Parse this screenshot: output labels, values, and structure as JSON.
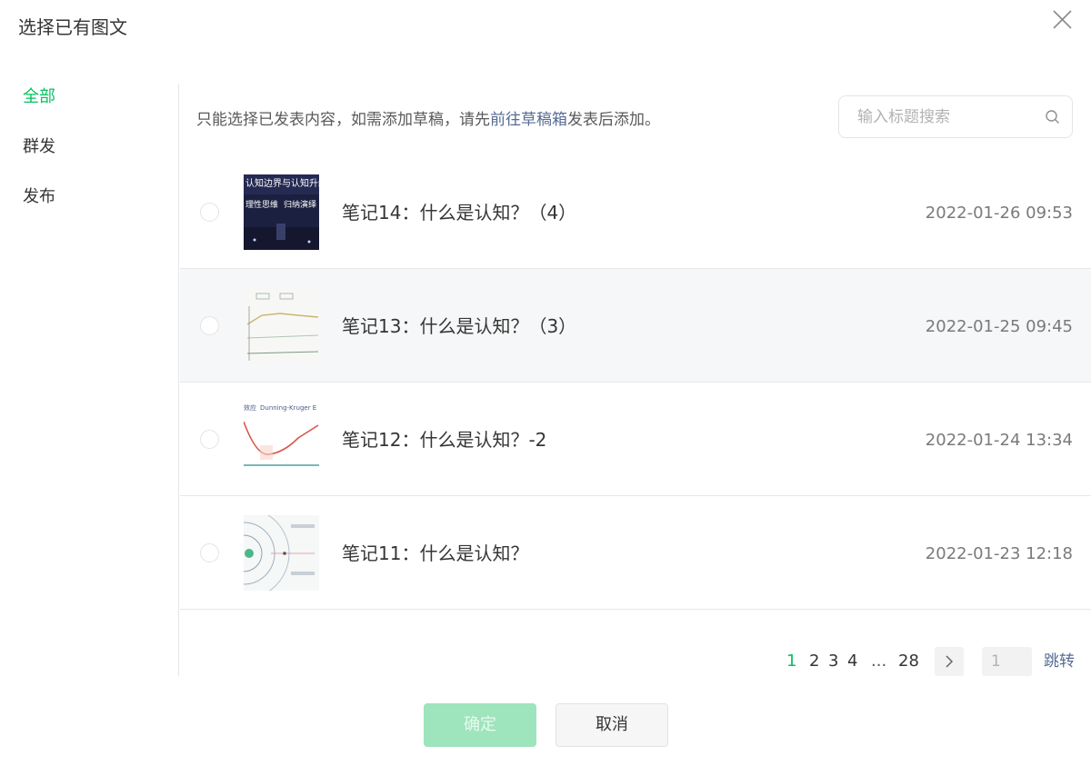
{
  "dialog": {
    "title": "选择已有图文"
  },
  "sidebar": {
    "items": [
      {
        "label": "全部",
        "active": true
      },
      {
        "label": "群发",
        "active": false
      },
      {
        "label": "发布",
        "active": false
      }
    ]
  },
  "notice": {
    "prefix": "只能选择已发表内容，如需添加草稿，请先",
    "link": "前往草稿箱",
    "suffix": "发表后添加。"
  },
  "search": {
    "placeholder": "输入标题搜索"
  },
  "articles": [
    {
      "title": "笔记14：什么是认知？（4）",
      "date": "2022-01-26 09:53",
      "thumb_text_1": "认知边界与认知升级",
      "thumb_text_2": "理性思维",
      "thumb_text_3": "归纳演绎"
    },
    {
      "title": "笔记13：什么是认知？（3）",
      "date": "2022-01-25 09:45"
    },
    {
      "title": "笔记12：什么是认知？-2",
      "date": "2022-01-24 13:34",
      "thumb_text_1": "效应",
      "thumb_text_2": "Dunning-Kruger E"
    },
    {
      "title": "笔记11：什么是认知？",
      "date": "2022-01-23 12:18"
    }
  ],
  "pagination": {
    "pages": [
      "1",
      "2",
      "3",
      "4"
    ],
    "ellipsis": "...",
    "last": "28",
    "current": "1",
    "input_placeholder": "1",
    "jump_label": "跳转"
  },
  "footer": {
    "confirm_label": "确定",
    "cancel_label": "取消"
  },
  "colors": {
    "accent": "#07c160",
    "link": "#576b95",
    "confirm_disabled": "#9ee4bd"
  }
}
